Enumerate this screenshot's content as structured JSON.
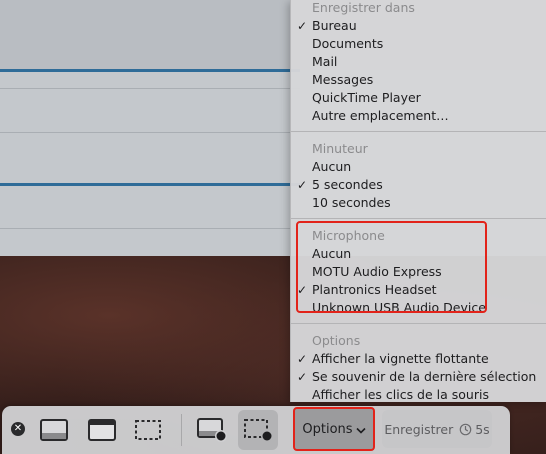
{
  "menu": {
    "save_section": {
      "header": "Enregistrer dans",
      "items": [
        {
          "label": "Bureau",
          "checked": true
        },
        {
          "label": "Documents",
          "checked": false
        },
        {
          "label": "Mail",
          "checked": false
        },
        {
          "label": "Messages",
          "checked": false
        },
        {
          "label": "QuickTime Player",
          "checked": false
        },
        {
          "label": "Autre emplacement…",
          "checked": false
        }
      ]
    },
    "timer_section": {
      "header": "Minuteur",
      "items": [
        {
          "label": "Aucun",
          "checked": false
        },
        {
          "label": "5 secondes",
          "checked": true
        },
        {
          "label": "10 secondes",
          "checked": false
        }
      ]
    },
    "microphone_section": {
      "header": "Microphone",
      "items": [
        {
          "label": "Aucun",
          "checked": false
        },
        {
          "label": "MOTU Audio Express",
          "checked": false
        },
        {
          "label": "Plantronics Headset",
          "checked": true
        },
        {
          "label": "Unknown USB Audio Device",
          "checked": false
        }
      ]
    },
    "options_section": {
      "header": "Options",
      "items": [
        {
          "label": "Afficher la vignette flottante",
          "checked": true
        },
        {
          "label": "Se souvenir de la dernière sélection",
          "checked": true
        },
        {
          "label": "Afficher les clics de la souris",
          "checked": false
        }
      ]
    },
    "check_glyph": "✓"
  },
  "toolbar": {
    "close_glyph": "✕",
    "options_label": "Options",
    "record_label": "Enregistrer",
    "record_timer": "5s",
    "icons": [
      "capture-entire-screen-icon",
      "capture-window-icon",
      "capture-selection-icon",
      "record-entire-screen-icon",
      "record-selection-icon",
      "timer-icon",
      "chevron-down-icon"
    ],
    "selected_tool": "record-selection"
  },
  "colors": {
    "highlight": "#e2231a",
    "accent_line": "#2f6c98"
  }
}
